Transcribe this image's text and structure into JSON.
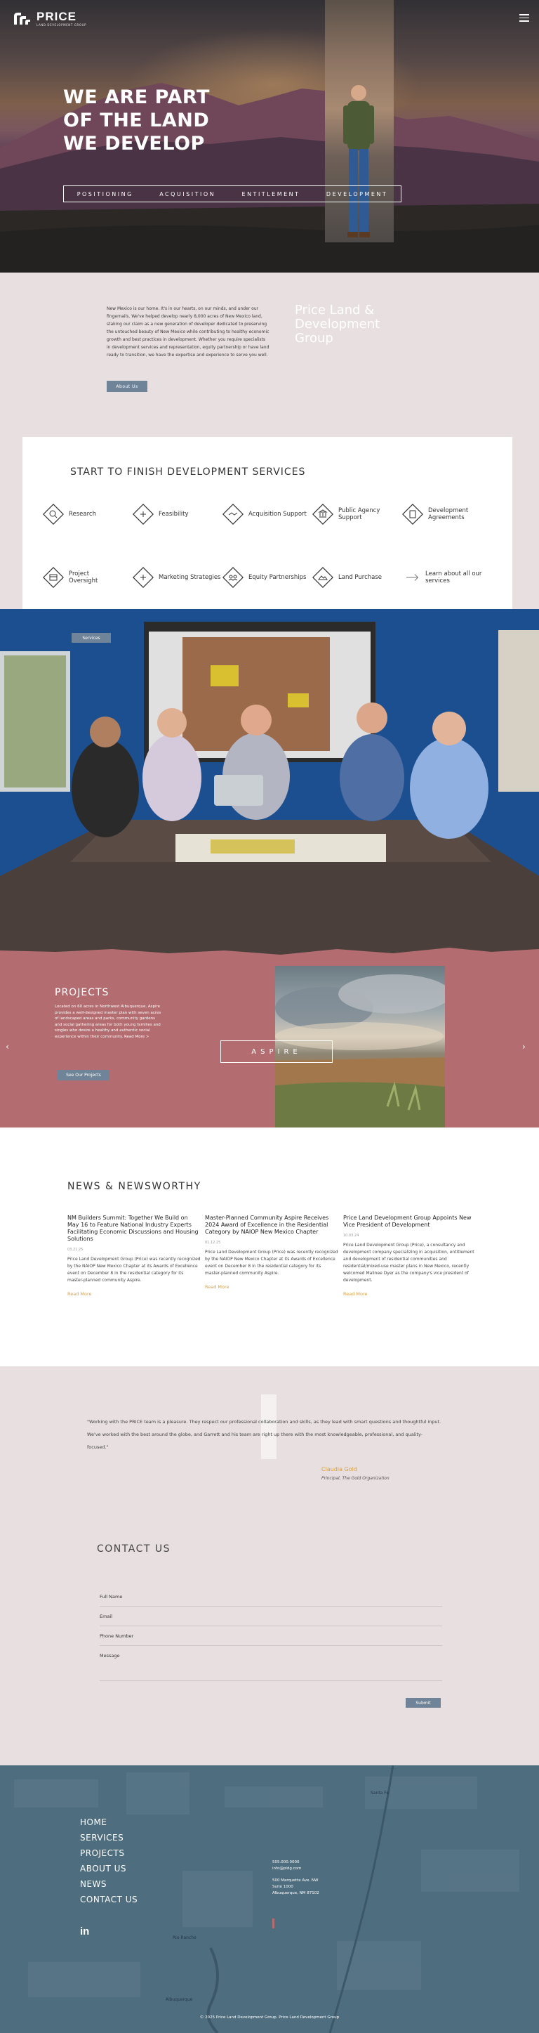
{
  "brand": {
    "name": "PRICE",
    "tagline": "LAND DEVELOPMENT GROUP"
  },
  "hero": {
    "title_lines": [
      "WE ARE PART",
      "OF THE LAND",
      "WE DEVELOP"
    ],
    "nav": [
      "POSITIONING",
      "ACQUISITION",
      "ENTITLEMENT",
      "DEVELOPMENT"
    ]
  },
  "intro": {
    "text": "New Mexico is our home. It's in our hearts, on our minds, and under our fingernails. We've helped develop nearly 8,000 acres of New Mexico land, staking our claim as a new generation of developer dedicated to preserving the untouched beauty of New Mexico while contributing to healthy economic growth and best practices in development. Whether you require specialists in development services and representation, equity partnership or have land ready to transition, we have the expertise and experience to serve you well.",
    "button": "About Us",
    "company": "Price Land & Development Group"
  },
  "services": {
    "title": "START TO FINISH DEVELOPMENT SERVICES",
    "items": [
      {
        "label": "Research",
        "icon": "magnifier-diamond-icon"
      },
      {
        "label": "Feasibility",
        "icon": "checklist-diamond-icon"
      },
      {
        "label": "Acquisition Support",
        "icon": "handshake-diamond-icon"
      },
      {
        "label": "Public Agency Support",
        "icon": "building-diamond-icon"
      },
      {
        "label": "Development Agreements",
        "icon": "document-diamond-icon"
      },
      {
        "label": "Project Oversight",
        "icon": "eye-diamond-icon"
      },
      {
        "label": "Marketing Strategies",
        "icon": "megaphone-diamond-icon"
      },
      {
        "label": "Equity Partnerships",
        "icon": "partners-diamond-icon"
      },
      {
        "label": "Land Purchase",
        "icon": "land-diamond-icon"
      }
    ],
    "learn_more": "Learn about all our services"
  },
  "team": {
    "button": "Services"
  },
  "projects": {
    "title": "PROJECTS",
    "text": "Located on 60 acres in Northwest Albuquerque, Aspire provides a well-designed master plan with seven acres of landscaped areas and parks, community gardens and social gathering areas for both young families and singles who desire a healthy and authentic social experience within their community. Read More >",
    "button": "See Our Projects",
    "featured": "ASPIRE"
  },
  "news": {
    "title": "NEWS & NEWSWORTHY",
    "items": [
      {
        "title": "NM Builders Summit: Together We Build on May 16 to Feature National Industry Experts Facilitating Economic Discussions and Housing Solutions",
        "date": "03.21.25",
        "excerpt": "Price Land Development Group (Price) was recently recognized by the NAIOP New Mexico Chapter at its Awards of Excellence event on December 8 in the residential category for its master-planned community Aspire.",
        "more": "Read More"
      },
      {
        "title": "Master-Planned Community Aspire Receives 2024 Award of Excellence in the Residential Category by NAIOP New Mexico Chapter",
        "date": "01.12.25",
        "excerpt": "Price Land Development Group (Price) was recently recognized by the NAIOP New Mexico Chapter at its Awards of Excellence event on December 8 in the residential category for its master-planned community Aspire.",
        "more": "Read More"
      },
      {
        "title": "Price Land Development Group Appoints New Vice President of Development",
        "date": "10.03.24",
        "excerpt": "Price Land Development Group (Price), a consultancy and development company specializing in acquisition, entitlement and development of residential communities and residential/mixed-use master plans in New Mexico, recently welcomed Malinee Dyer as the company's vice president of development.",
        "more": "Read More"
      }
    ]
  },
  "testimonial": {
    "quote": "\"Working with the PRICE team is a pleasure. They respect our professional collaboration and skills, as they lead with smart questions and thoughtful input. We've worked with the best around the globe, and Garrett and his team are right up there with the most knowledgeable, professional, and quality-focused.\"",
    "name": "Claudia Gold",
    "role": "Principal, The Gold Organization"
  },
  "contact": {
    "title": "CONTACT US",
    "fields": [
      "Full Name",
      "Email",
      "Phone Number",
      "Message"
    ],
    "submit": "Submit"
  },
  "footer": {
    "nav": [
      "HOME",
      "SERVICES",
      "PROJECTS",
      "ABOUT US",
      "NEWS",
      "CONTACT US"
    ],
    "phone": "505.000.0000",
    "email": "info@pldg.com",
    "address1": "500 Marquette Ave. NW",
    "address2": "Suite 1000",
    "address3": "Albuquerque, NM 87102",
    "social": "in",
    "copyright": "© 2025 Price Land Development Group. Price Land Development Group",
    "map_labels": [
      "Santa Fe",
      "Rio Rancho",
      "Albuquerque"
    ]
  },
  "colors": {
    "accent_blue": "#6f8498",
    "rose": "#b36c6f",
    "gold": "#d9a040",
    "footer": "#4e6d7e",
    "bg": "#e8dfe0"
  }
}
